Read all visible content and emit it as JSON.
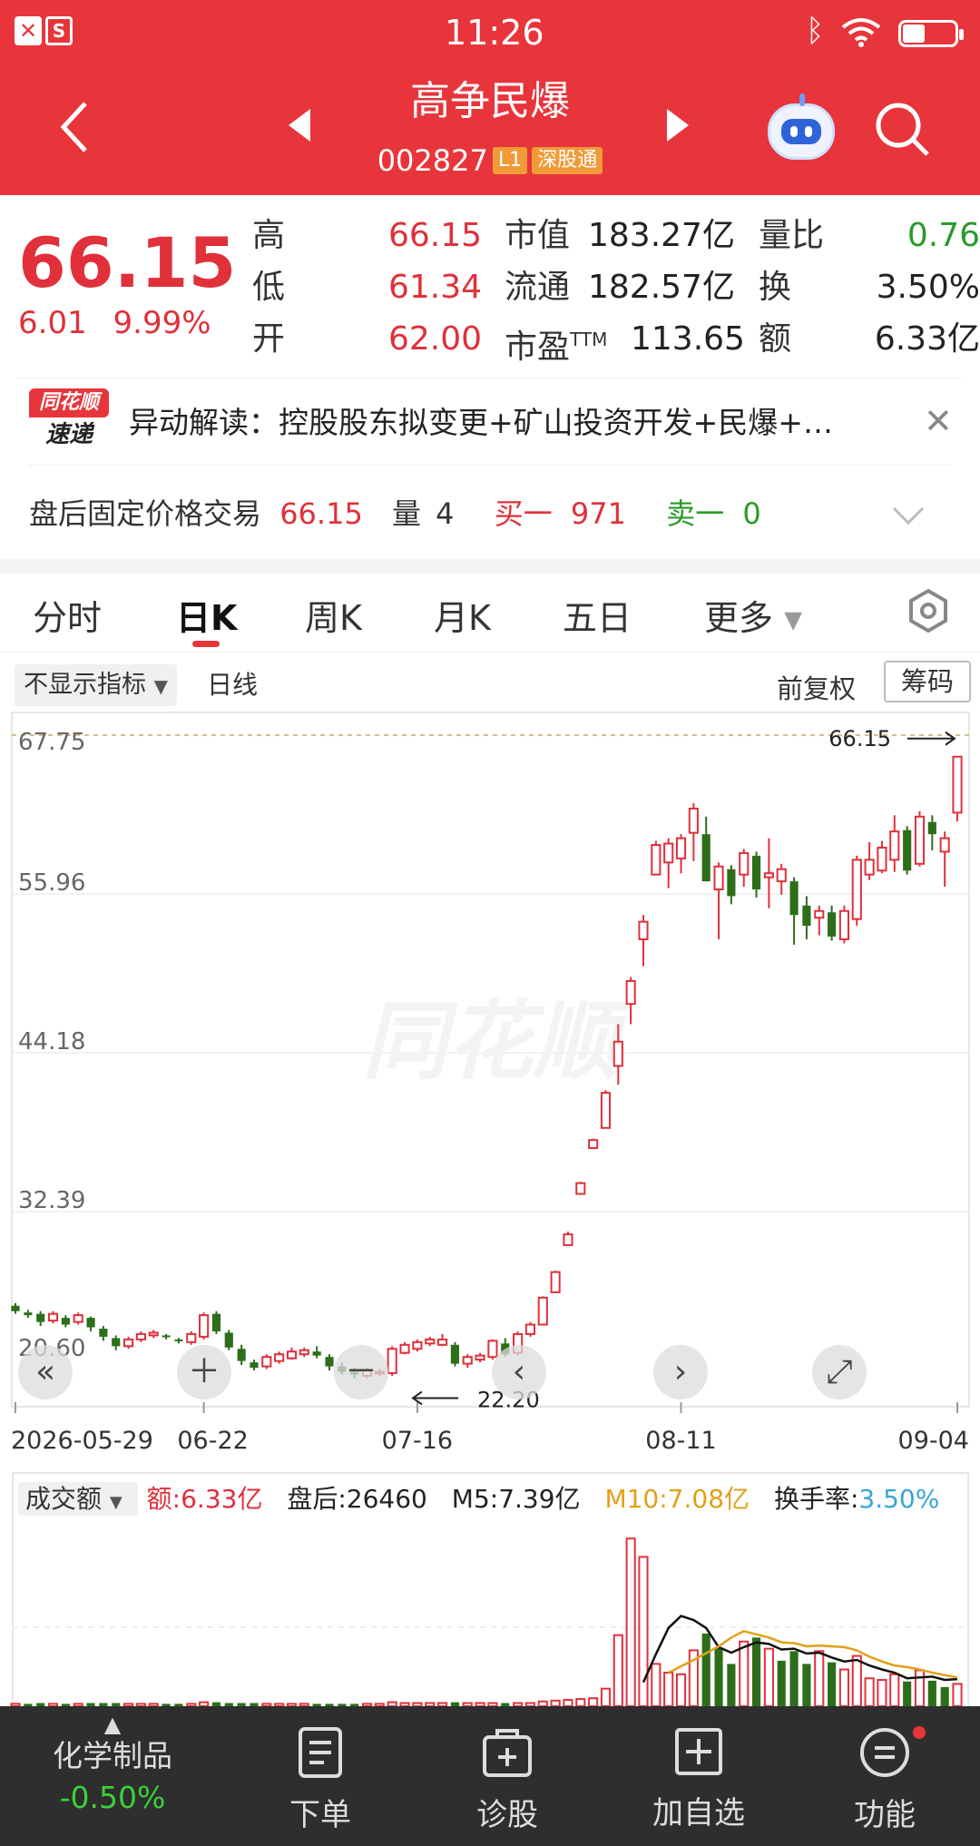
{
  "status_bar": {
    "time": "11:26"
  },
  "header": {
    "title": "高争民爆",
    "code": "002827",
    "level_tag": "L1",
    "market_tag": "深股通"
  },
  "quote": {
    "price": "66.15",
    "change": "6.01",
    "change_pct": "9.99%",
    "high_label": "高",
    "high": "66.15",
    "low_label": "低",
    "low": "61.34",
    "open_label": "开",
    "open": "62.00",
    "mktcap_label": "市值",
    "mktcap": "183.27亿",
    "float_label": "流通",
    "float": "182.57亿",
    "pe_label": "市盈",
    "pe_sup": "TTM",
    "pe": "113.65",
    "volratio_label": "量比",
    "volratio": "0.76",
    "turnover_label": "换",
    "turnover": "3.50%",
    "amount_label": "额",
    "amount": "6.33亿"
  },
  "news": {
    "logo_top": "同花顺",
    "logo_bottom": "速递",
    "text": "异动解读：控股股东拟变更+矿山投资开发+民爆+…"
  },
  "after_hours": {
    "label": "盘后固定价格交易",
    "price": "66.15",
    "vol_label": "量",
    "vol": "4",
    "buy_label": "买一",
    "buy": "971",
    "sell_label": "卖一",
    "sell": "0"
  },
  "tabs": [
    "分时",
    "日K",
    "周K",
    "月K",
    "五日",
    "更多"
  ],
  "active_tab": "日K",
  "chart_toolbar": {
    "indicator": "不显示指标",
    "line_type": "日线",
    "adjust": "前复权",
    "chip": "筹码"
  },
  "watermark": "同花顺",
  "volume_panel": {
    "metric": "成交额",
    "amount": "额:6.33亿",
    "after": "盘后:26460",
    "m5": "M5:7.39亿",
    "m10": "M10:7.08亿",
    "turnover_label": "换手率:",
    "turnover": "3.50%"
  },
  "bottom_nav": {
    "sector": "化学制品",
    "sector_change": "-0.50%",
    "items": [
      "下单",
      "诊股",
      "加自选",
      "功能"
    ]
  },
  "colors": {
    "up": "#e0303a",
    "down": "#2c6e1a",
    "header": "#e8353b",
    "m10": "#e2a019"
  },
  "chart_data": {
    "type": "candlestick",
    "y_ticks": [
      "67.75",
      "55.96",
      "44.18",
      "32.39",
      "20.60"
    ],
    "ylim": [
      20.6,
      67.75
    ],
    "x_ticks": [
      "2026-05-29",
      "06-22",
      "07-16",
      "08-11",
      "09-04"
    ],
    "max_label": "66.15",
    "min_label": "22.20",
    "candles": [
      [
        25.4,
        25.0,
        25.6,
        24.8
      ],
      [
        24.9,
        24.7,
        25.1,
        24.5
      ],
      [
        24.8,
        24.2,
        25.0,
        23.9
      ],
      [
        24.3,
        24.8,
        25.0,
        24.1
      ],
      [
        24.5,
        24.0,
        24.7,
        23.8
      ],
      [
        24.2,
        24.7,
        24.9,
        24.0
      ],
      [
        24.5,
        23.8,
        24.6,
        23.5
      ],
      [
        23.7,
        23.1,
        23.9,
        22.8
      ],
      [
        23.0,
        22.4,
        23.2,
        22.1
      ],
      [
        22.4,
        22.9,
        23.1,
        22.2
      ],
      [
        22.9,
        23.3,
        23.5,
        22.7
      ],
      [
        23.2,
        23.4,
        23.6,
        23.0
      ],
      [
        23.2,
        23.1,
        23.3,
        22.9
      ],
      [
        22.9,
        22.8,
        23.0,
        22.6
      ],
      [
        22.7,
        23.3,
        23.5,
        22.5
      ],
      [
        23.1,
        24.7,
        24.9,
        22.9
      ],
      [
        24.8,
        23.5,
        25.0,
        23.3
      ],
      [
        23.4,
        22.3,
        23.6,
        22.1
      ],
      [
        22.2,
        21.3,
        22.5,
        21.0
      ],
      [
        21.2,
        20.8,
        21.4,
        20.6
      ],
      [
        20.9,
        21.6,
        21.8,
        20.7
      ],
      [
        21.3,
        21.8,
        22.0,
        21.1
      ],
      [
        21.5,
        22.0,
        22.3,
        21.4
      ],
      [
        21.8,
        22.1,
        22.3,
        21.6
      ],
      [
        22.0,
        21.7,
        22.4,
        21.5
      ],
      [
        21.6,
        20.9,
        21.8,
        20.6
      ],
      [
        20.9,
        20.5,
        21.2,
        20.3
      ],
      [
        20.5,
        20.3,
        20.8,
        20.0
      ],
      [
        20.2,
        20.6,
        20.8,
        20.0
      ],
      [
        20.4,
        20.5,
        20.7,
        20.2
      ],
      [
        20.4,
        22.2,
        22.4,
        20.2
      ],
      [
        21.9,
        22.5,
        22.7,
        21.8
      ],
      [
        22.2,
        22.7,
        22.9,
        22.0
      ],
      [
        22.6,
        22.9,
        23.1,
        22.4
      ],
      [
        22.5,
        22.9,
        23.3,
        22.4
      ],
      [
        22.5,
        21.1,
        22.7,
        20.9
      ],
      [
        21.1,
        21.6,
        21.8,
        20.8
      ],
      [
        21.4,
        21.7,
        21.9,
        21.2
      ],
      [
        21.6,
        22.8,
        22.9,
        21.4
      ],
      [
        22.6,
        21.8,
        23.0,
        21.6
      ],
      [
        21.9,
        23.3,
        23.5,
        21.7
      ],
      [
        23.3,
        24.0,
        24.2,
        23.1
      ],
      [
        24.0,
        26.0,
        26.1,
        24.0
      ],
      [
        26.4,
        27.9,
        28.0,
        26.4
      ],
      [
        29.9,
        30.7,
        30.9,
        29.9
      ],
      [
        33.7,
        34.5,
        34.6,
        33.7
      ],
      [
        37.1,
        37.7,
        37.8,
        37.1
      ],
      [
        38.6,
        41.2,
        41.4,
        38.6
      ],
      [
        43.2,
        45.0,
        46.3,
        41.8
      ],
      [
        47.8,
        49.5,
        49.8,
        46.3
      ],
      [
        52.6,
        53.9,
        54.4,
        50.6
      ],
      [
        57.4,
        59.6,
        59.9,
        57.4
      ],
      [
        58.3,
        59.7,
        60.1,
        56.4
      ],
      [
        58.6,
        60.1,
        60.4,
        57.5
      ],
      [
        60.5,
        62.3,
        62.7,
        58.4
      ],
      [
        60.4,
        56.9,
        61.7,
        56.9
      ],
      [
        56.3,
        58.0,
        58.3,
        52.6
      ],
      [
        57.8,
        55.8,
        58.1,
        55.2
      ],
      [
        57.4,
        59.0,
        59.3,
        56.5
      ],
      [
        58.8,
        56.3,
        59.1,
        55.7
      ],
      [
        57.2,
        57.5,
        60.1,
        54.9
      ],
      [
        56.9,
        57.8,
        58.2,
        55.9
      ],
      [
        56.9,
        54.4,
        57.2,
        52.2
      ],
      [
        55.1,
        53.6,
        55.8,
        52.6
      ],
      [
        54.2,
        54.7,
        55.1,
        52.9
      ],
      [
        54.6,
        52.8,
        55.1,
        52.5
      ],
      [
        52.6,
        54.7,
        55.1,
        52.3
      ],
      [
        54.1,
        58.5,
        58.8,
        53.6
      ],
      [
        57.4,
        58.5,
        59.8,
        57.0
      ],
      [
        57.7,
        59.4,
        59.9,
        57.5
      ],
      [
        58.5,
        60.6,
        61.8,
        57.6
      ],
      [
        60.7,
        57.7,
        61.0,
        57.4
      ],
      [
        58.2,
        61.7,
        62.1,
        58.0
      ],
      [
        61.3,
        60.4,
        61.8,
        59.2
      ],
      [
        59.1,
        60.1,
        60.6,
        56.5
      ],
      [
        62.0,
        66.15,
        66.15,
        61.34
      ]
    ],
    "volume": [
      [
        0.3,
        1
      ],
      [
        0.3,
        0
      ],
      [
        0.4,
        0
      ],
      [
        0.3,
        1
      ],
      [
        0.3,
        0
      ],
      [
        0.3,
        1
      ],
      [
        0.4,
        0
      ],
      [
        0.4,
        0
      ],
      [
        0.4,
        0
      ],
      [
        0.3,
        1
      ],
      [
        0.3,
        1
      ],
      [
        0.3,
        1
      ],
      [
        0.3,
        0
      ],
      [
        0.3,
        0
      ],
      [
        0.3,
        1
      ],
      [
        0.5,
        1
      ],
      [
        0.5,
        0
      ],
      [
        0.4,
        0
      ],
      [
        0.4,
        0
      ],
      [
        0.4,
        0
      ],
      [
        0.3,
        1
      ],
      [
        0.3,
        1
      ],
      [
        0.3,
        1
      ],
      [
        0.3,
        1
      ],
      [
        0.3,
        0
      ],
      [
        0.3,
        0
      ],
      [
        0.3,
        0
      ],
      [
        0.3,
        0
      ],
      [
        0.3,
        1
      ],
      [
        0.3,
        1
      ],
      [
        0.5,
        1
      ],
      [
        0.4,
        1
      ],
      [
        0.4,
        1
      ],
      [
        0.4,
        1
      ],
      [
        0.4,
        1
      ],
      [
        0.5,
        0
      ],
      [
        0.4,
        1
      ],
      [
        0.4,
        1
      ],
      [
        0.4,
        1
      ],
      [
        0.4,
        0
      ],
      [
        0.4,
        1
      ],
      [
        0.4,
        1
      ],
      [
        0.6,
        1
      ],
      [
        0.7,
        1
      ],
      [
        0.8,
        1
      ],
      [
        0.9,
        1
      ],
      [
        1.0,
        1
      ],
      [
        2.2,
        1
      ],
      [
        8.9,
        1
      ],
      [
        21.0,
        1
      ],
      [
        18.7,
        1
      ],
      [
        5.3,
        1
      ],
      [
        4.2,
        1
      ],
      [
        4.0,
        1
      ],
      [
        7.0,
        1
      ],
      [
        9.1,
        0
      ],
      [
        7.3,
        0
      ],
      [
        5.3,
        0
      ],
      [
        8.1,
        1
      ],
      [
        8.6,
        0
      ],
      [
        7.2,
        1
      ],
      [
        5.7,
        0
      ],
      [
        6.9,
        0
      ],
      [
        5.3,
        0
      ],
      [
        6.9,
        1
      ],
      [
        5.5,
        0
      ],
      [
        4.6,
        1
      ],
      [
        6.3,
        1
      ],
      [
        3.5,
        1
      ],
      [
        3.3,
        1
      ],
      [
        4.0,
        1
      ],
      [
        3.1,
        0
      ],
      [
        4.5,
        1
      ],
      [
        3.2,
        0
      ],
      [
        2.4,
        0
      ],
      [
        2.8,
        1
      ]
    ],
    "m5_line": [
      [
        50,
        3
      ],
      [
        51,
        6.5
      ],
      [
        52,
        9.8
      ],
      [
        53,
        11.3
      ],
      [
        54,
        10.8
      ],
      [
        55,
        9.8
      ],
      [
        56,
        7.4
      ],
      [
        57,
        6.7
      ],
      [
        58,
        7.4
      ],
      [
        59,
        8.0
      ],
      [
        60,
        7.8
      ],
      [
        61,
        7.1
      ],
      [
        62,
        7.2
      ],
      [
        63,
        6.6
      ],
      [
        64,
        6.7
      ],
      [
        65,
        6.1
      ],
      [
        66,
        5.6
      ],
      [
        67,
        5.8
      ],
      [
        68,
        5.1
      ],
      [
        69,
        4.6
      ],
      [
        70,
        4.2
      ],
      [
        71,
        3.5
      ],
      [
        72,
        3.6
      ],
      [
        73,
        3.7
      ],
      [
        74,
        3.3
      ],
      [
        75,
        3.4
      ]
    ],
    "m10_line": [
      [
        52,
        4.2
      ],
      [
        54,
        5.8
      ],
      [
        56,
        7.5
      ],
      [
        57,
        8.6
      ],
      [
        58,
        9.4
      ],
      [
        59,
        9.0
      ],
      [
        60,
        8.6
      ],
      [
        61,
        8.0
      ],
      [
        62,
        7.9
      ],
      [
        63,
        7.5
      ],
      [
        64,
        7.6
      ],
      [
        65,
        7.5
      ],
      [
        66,
        7.4
      ],
      [
        67,
        7.0
      ],
      [
        68,
        6.2
      ],
      [
        69,
        5.6
      ],
      [
        70,
        5.1
      ],
      [
        71,
        4.9
      ],
      [
        72,
        4.6
      ],
      [
        73,
        4.2
      ],
      [
        74,
        3.9
      ],
      [
        75,
        3.6
      ]
    ]
  }
}
